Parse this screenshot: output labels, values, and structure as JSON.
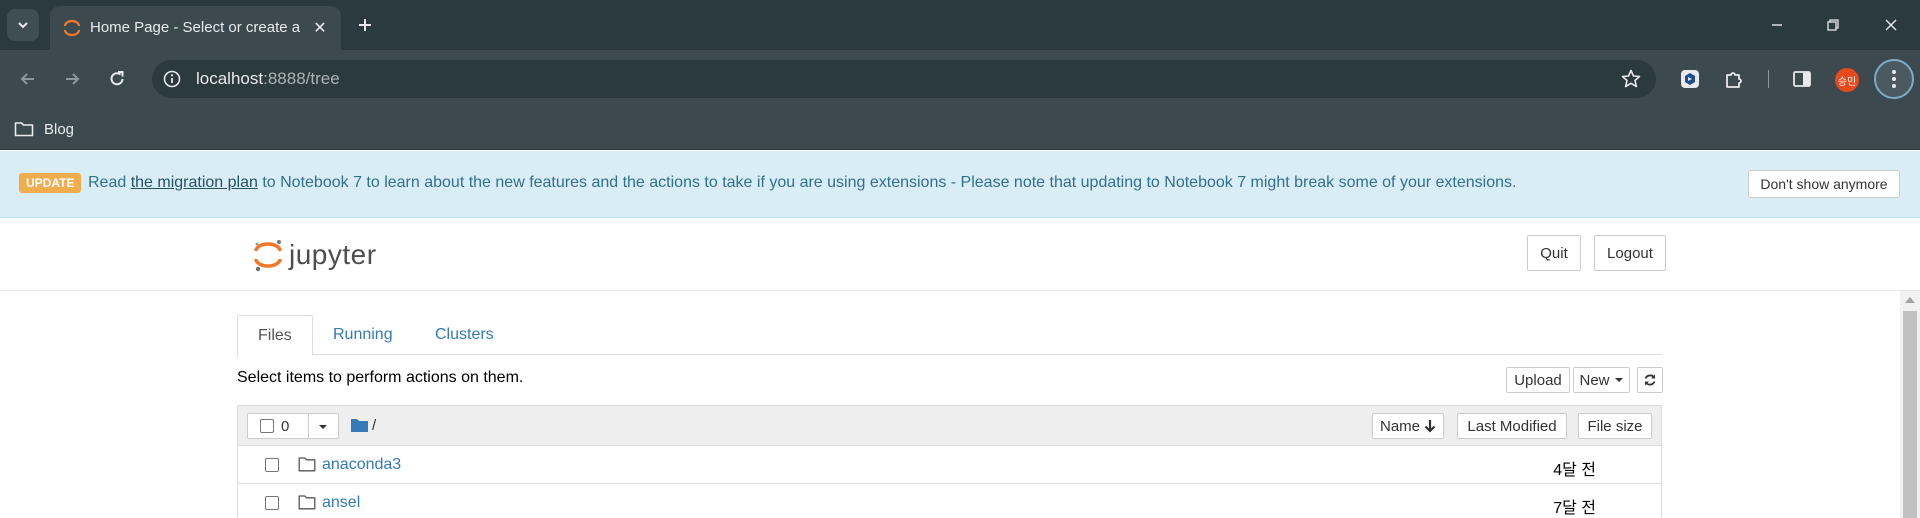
{
  "browser": {
    "tab_title": "Home Page - Select or create a notebook",
    "tab_close": "✕",
    "url_host": "localhost",
    "url_rest": ":8888/tree",
    "bookmark": "Blog",
    "profile_initials": "승민",
    "icons": {
      "tab_menu": "chevron-down-icon",
      "new_tab": "plus-icon",
      "back": "arrow-left-icon",
      "forward": "arrow-right-icon",
      "reload": "reload-icon",
      "info": "info-icon",
      "star": "star-icon",
      "extension1": "extension-icon",
      "extensions": "puzzle-icon",
      "sidebar": "side-panel-icon",
      "menu": "kebab-menu-icon"
    }
  },
  "alert": {
    "label": "UPDATE",
    "text_before": "Read ",
    "link": "the migration plan",
    "text_after": " to Notebook 7 to learn about the new features and the actions to take if you are using extensions - Please note that updating to Notebook 7 might break some of your extensions.",
    "dismiss": "Don't show anymore"
  },
  "header": {
    "logo_text": "jupyter",
    "quit": "Quit",
    "logout": "Logout"
  },
  "tabs": [
    {
      "label": "Files",
      "active": true
    },
    {
      "label": "Running",
      "active": false
    },
    {
      "label": "Clusters",
      "active": false
    }
  ],
  "toolbar": {
    "hint": "Select items to perform actions on them.",
    "upload": "Upload",
    "new": "New"
  },
  "list": {
    "selected_count": "0",
    "path": "/",
    "col_name": "Name",
    "col_modified": "Last Modified",
    "col_size": "File size",
    "rows": [
      {
        "name": "anaconda3",
        "modified": "4달 전",
        "type": "folder"
      },
      {
        "name": "ansel",
        "modified": "7달 전",
        "type": "folder"
      }
    ]
  },
  "colors": {
    "chrome_dark": "#2b3a3f",
    "chrome": "#3c4a4f",
    "alert_bg": "#d9edf7",
    "alert_text": "#31708f",
    "update_label": "#f0ad4e",
    "link": "#337ab7",
    "jupyter_orange": "#f37726"
  }
}
